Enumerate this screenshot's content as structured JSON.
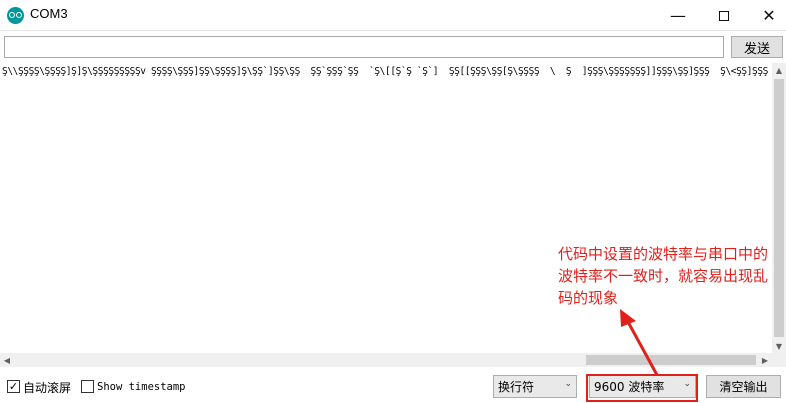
{
  "window": {
    "title": "COM3",
    "minimize_glyph": "—",
    "close_glyph": "✕"
  },
  "send_row": {
    "input_value": "",
    "send_label": "发送"
  },
  "output": {
    "text": "Ş\\\\ŞŞŞŞ\\ŞŞŞŞ]Ş]Ş\\ŞŞŞŞŞŞŞŞŞv ŞŞŞŞ\\ŞŞŞ]ŞŞ\\ŞŞŞŞ]Ş\\ŞŞ`]ŞŞ\\ŞŞ  ŞŞ`ŞŞŞ`ŞŞ  `Ş\\[[Ş`Ş `Ş`]  ŞŞ[[ŞŞŞ\\ŞŞ[Ş\\ŞŞŞŞ  \\  Ş  ]ŞŞŞ\\ŞŞŞŞŞŞŞ]]ŞŞŞ\\ŞŞ]ŞŞŞ  Ş\\<ŞŞ]ŞŞŞ  ŞŞŞŞŞvŞŞ"
  },
  "bottom_bar": {
    "autoscroll_label": "自动滚屏",
    "autoscroll_checked": true,
    "check_glyph": "✓",
    "timestamp_label": "Show timestamp",
    "timestamp_checked": false,
    "line_ending_value": "换行符",
    "baud_value": "9600 波特率",
    "clear_label": "清空输出"
  },
  "annotation": {
    "lines": [
      "代码中设置的波特率与串口中的",
      "波特率不一致时，就容易出现乱",
      "码的现象"
    ],
    "color": "#e0201a"
  },
  "colors": {
    "accent_icon": "#00979c",
    "highlight": "#e0201a"
  }
}
